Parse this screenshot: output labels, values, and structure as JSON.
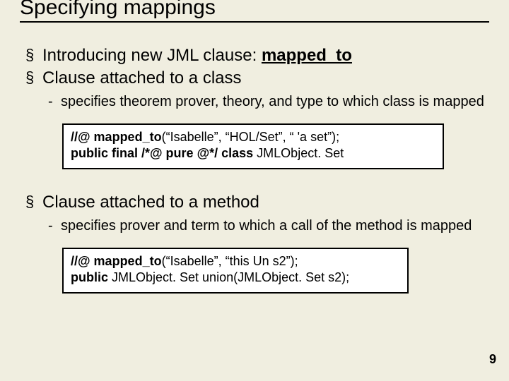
{
  "title": "Specifying mappings",
  "b1": "Introducing new JML clause: ",
  "b1_kw": "mapped_to",
  "b2": "Clause attached to a class",
  "b2_sub": "specifies theorem prover, theory, and type to which class is mapped",
  "code1": {
    "l1a": "//@ mapped_to",
    "l1b": "(“Isabelle”, “HOL/Set”, “ 'a set”);",
    "l2a": "public final /*@ pure @*/ class ",
    "l2b": "JMLObject. Set"
  },
  "b3": "Clause attached to a method",
  "b3_sub": "specifies prover and term to which a call of the method is mapped",
  "code2": {
    "l1a": "//@ mapped_to",
    "l1b": "(“Isabelle”, “this Un s2”);",
    "l2a": "public ",
    "l2b": "JMLObject. Set union(JMLObject. Set s2);"
  },
  "pagenum": "9"
}
